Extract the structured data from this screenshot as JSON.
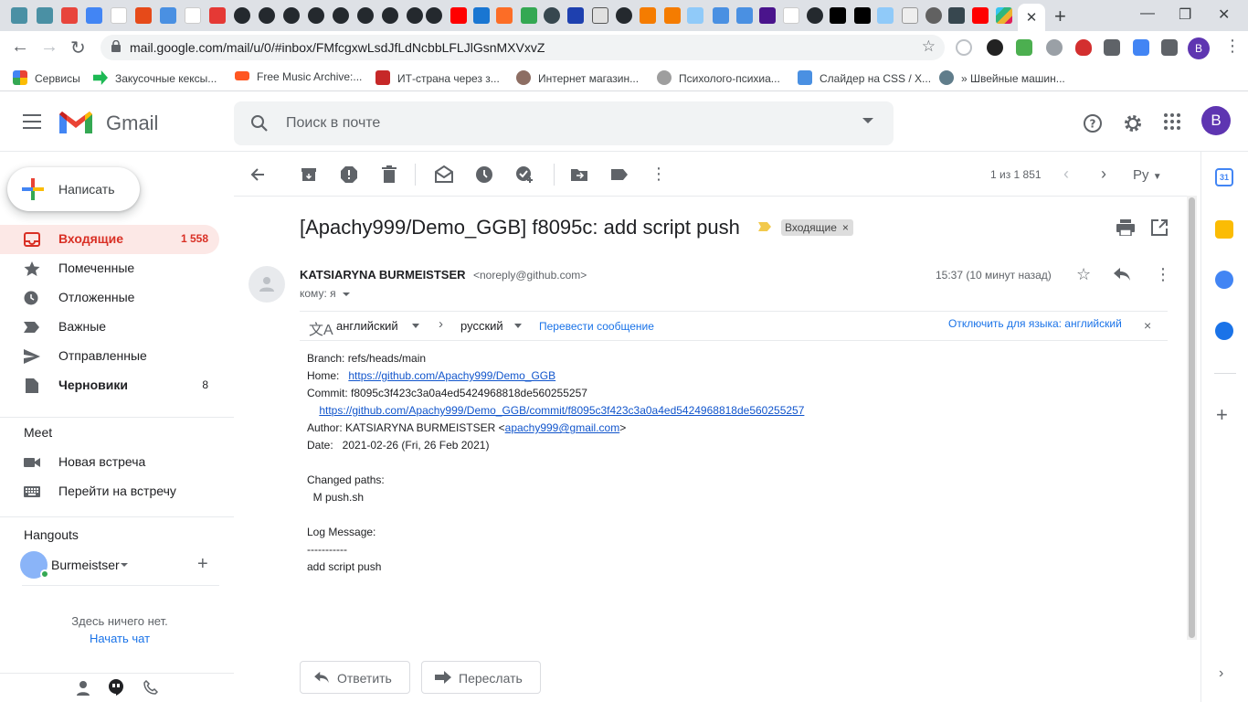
{
  "browser": {
    "tab_close": "✕",
    "new_tab": "+",
    "url": "mail.google.com/mail/u/0/#inbox/FMfcgxwLsdJfLdNcbbLFLJlGsnMXVxvZ",
    "profile_initial": "B",
    "bookmarks": [
      {
        "label": "Сервисы",
        "color": "#ea4335"
      },
      {
        "label": "Закусочные кексы...",
        "color": "#1db954"
      },
      {
        "label": "Free Music Archive:...",
        "color": "#ff5722"
      },
      {
        "label": "ИТ-страна через з...",
        "color": "#c62828"
      },
      {
        "label": "Интернет магазин...",
        "color": "#8d6e63"
      },
      {
        "label": "Психолого-психиа...",
        "color": "#9e9e9e"
      },
      {
        "label": "Слайдер на CSS / Х...",
        "color": "#4a90e2"
      },
      {
        "label": "» Швейные машин...",
        "color": "#607d8b"
      }
    ]
  },
  "gmail": {
    "logo_text": "Gmail",
    "search_placeholder": "Поиск в почте",
    "avatar_initial": "B"
  },
  "sidebar": {
    "compose_label": "Написать",
    "items": [
      {
        "label": "Входящие",
        "count": "1 558"
      },
      {
        "label": "Помеченные",
        "count": ""
      },
      {
        "label": "Отложенные",
        "count": ""
      },
      {
        "label": "Важные",
        "count": ""
      },
      {
        "label": "Отправленные",
        "count": ""
      },
      {
        "label": "Черновики",
        "count": "8"
      }
    ],
    "meet_title": "Meet",
    "meet_items": [
      {
        "label": "Новая встреча"
      },
      {
        "label": "Перейти на встречу"
      }
    ],
    "hangouts_title": "Hangouts",
    "hangouts_user": "Burmeistser",
    "hangouts_empty": "Здесь ничего нет.",
    "hangouts_start": "Начать чат"
  },
  "toolbar": {
    "page_count": "1 из 1 851",
    "input_tool": "Ру"
  },
  "message": {
    "subject": "[Apachy999/Demo_GGB] f8095c: add script push",
    "label": "Входящие",
    "sender_name": "KATSIARYNA BURMEISTSER",
    "sender_email": "<noreply@github.com>",
    "recipient": "кому: я",
    "time": "15:37 (10 минут назад)",
    "translate": {
      "source_lang": "английский",
      "target_lang": "русский",
      "translate_link": "Перевести сообщение",
      "disable_link": "Отключить для языка: английский"
    },
    "body": {
      "branch": "Branch: refs/heads/main",
      "home_label": "Home:   ",
      "home_link": "https://github.com/Apachy999/Demo_GGB",
      "commit": "Commit: f8095c3f423c3a0a4ed5424968818de560255257",
      "commit_link": "https://github.com/Apachy999/Demo_GGB/commit/f8095c3f423c3a0a4ed5424968818de560255257",
      "author_prefix": "Author: KATSIARYNA BURMEISTSER <",
      "author_email": "apachy999@gmail.com",
      "author_suffix": ">",
      "date": "Date:   2021-02-26 (Fri, 26 Feb 2021)",
      "changed_paths": "Changed paths:",
      "path_entry": "  M push.sh",
      "log_message": "Log Message:",
      "dashes": "-----------",
      "log_text": "add script push"
    },
    "reply_label": "Ответить",
    "forward_label": "Переслать"
  },
  "colors": {
    "accent_red": "#d93025",
    "link_blue": "#1a73e8",
    "inbox_highlight": "#fce8e6"
  }
}
